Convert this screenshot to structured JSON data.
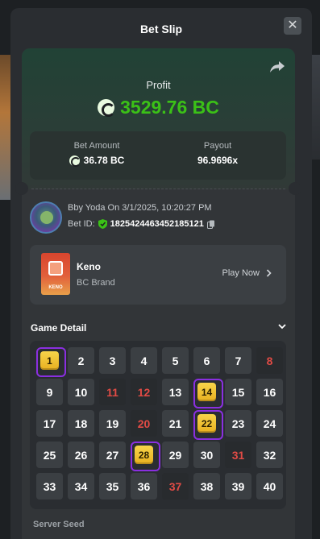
{
  "modal": {
    "title": "Bet Slip",
    "close_glyph": "✕"
  },
  "summary": {
    "profit_label": "Profit",
    "profit_value": "3529.76 BC",
    "bet_amount_label": "Bet Amount",
    "bet_amount_value": "36.78 BC",
    "payout_label": "Payout",
    "payout_value": "96.9696x",
    "accent_color": "#3bc117"
  },
  "user": {
    "line": "Bby Yoda On 3/1/2025, 10:20:27 PM",
    "bet_id_label": "Bet ID:",
    "bet_id_value": "1825424463452185121"
  },
  "game": {
    "name": "Keno",
    "brand": "BC Brand",
    "thumb_text": "KENO",
    "play_label": "Play Now"
  },
  "detail": {
    "header": "Game Detail",
    "cells": [
      {
        "n": "1",
        "state": "hit"
      },
      {
        "n": "2",
        "state": "normal"
      },
      {
        "n": "3",
        "state": "normal"
      },
      {
        "n": "4",
        "state": "normal"
      },
      {
        "n": "5",
        "state": "normal"
      },
      {
        "n": "6",
        "state": "normal"
      },
      {
        "n": "7",
        "state": "normal"
      },
      {
        "n": "8",
        "state": "red"
      },
      {
        "n": "9",
        "state": "normal"
      },
      {
        "n": "10",
        "state": "normal"
      },
      {
        "n": "11",
        "state": "red"
      },
      {
        "n": "12",
        "state": "red"
      },
      {
        "n": "13",
        "state": "normal"
      },
      {
        "n": "14",
        "state": "hit"
      },
      {
        "n": "15",
        "state": "normal"
      },
      {
        "n": "16",
        "state": "normal"
      },
      {
        "n": "17",
        "state": "normal"
      },
      {
        "n": "18",
        "state": "normal"
      },
      {
        "n": "19",
        "state": "normal"
      },
      {
        "n": "20",
        "state": "red"
      },
      {
        "n": "21",
        "state": "normal"
      },
      {
        "n": "22",
        "state": "hit"
      },
      {
        "n": "23",
        "state": "normal"
      },
      {
        "n": "24",
        "state": "normal"
      },
      {
        "n": "25",
        "state": "normal"
      },
      {
        "n": "26",
        "state": "normal"
      },
      {
        "n": "27",
        "state": "normal"
      },
      {
        "n": "28",
        "state": "hit"
      },
      {
        "n": "29",
        "state": "normal"
      },
      {
        "n": "30",
        "state": "normal"
      },
      {
        "n": "31",
        "state": "red"
      },
      {
        "n": "32",
        "state": "normal"
      },
      {
        "n": "33",
        "state": "normal"
      },
      {
        "n": "34",
        "state": "normal"
      },
      {
        "n": "35",
        "state": "normal"
      },
      {
        "n": "36",
        "state": "normal"
      },
      {
        "n": "37",
        "state": "red"
      },
      {
        "n": "38",
        "state": "normal"
      },
      {
        "n": "39",
        "state": "normal"
      },
      {
        "n": "40",
        "state": "normal"
      }
    ],
    "hit_color": "#8a2fe0",
    "miss_color": "#e14b45"
  },
  "footer": {
    "seed_label": "Server Seed"
  },
  "icons": [
    "close-icon",
    "share-icon",
    "coin-icon",
    "verified-shield-icon",
    "copy-icon",
    "chevron-right-icon",
    "chevron-down-icon"
  ]
}
